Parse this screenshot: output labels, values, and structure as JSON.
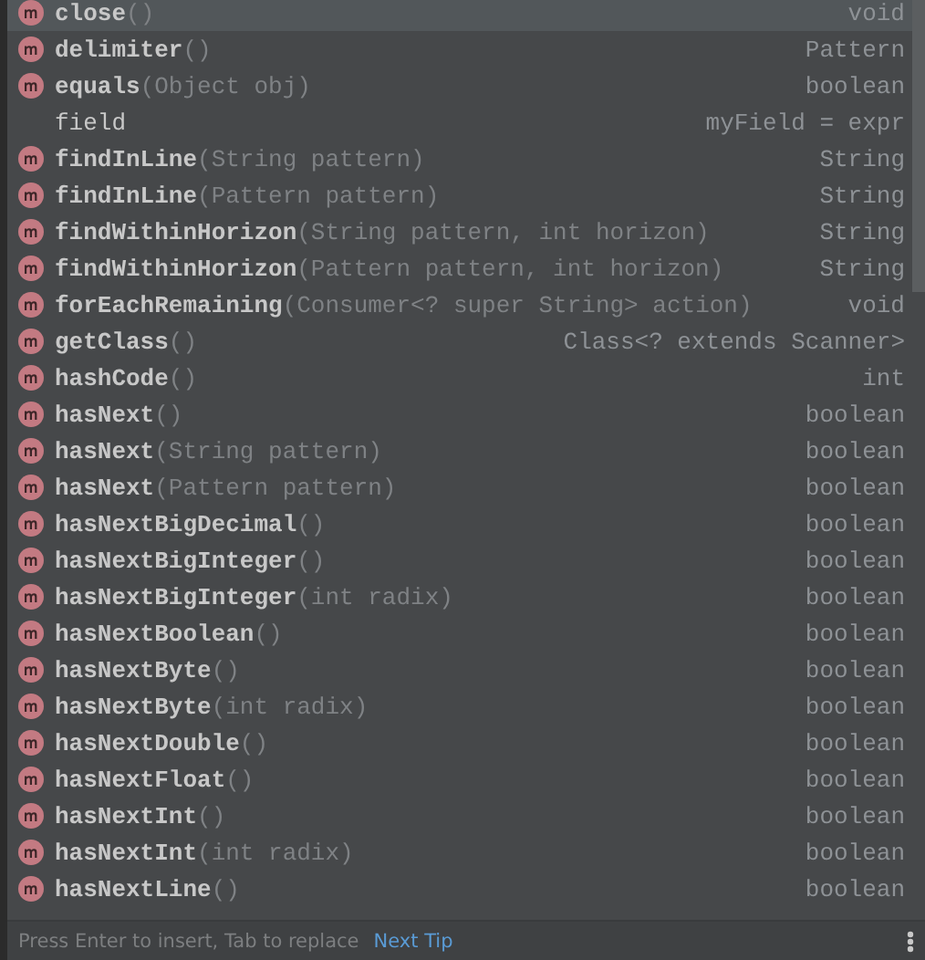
{
  "completion_list": {
    "items": [
      {
        "kind": "method",
        "name": "close",
        "params": "()",
        "type": "void",
        "selected": true
      },
      {
        "kind": "method",
        "name": "delimiter",
        "params": "()",
        "type": "Pattern",
        "selected": false
      },
      {
        "kind": "method",
        "name": "equals",
        "params": "(Object obj)",
        "type": "boolean",
        "selected": false
      },
      {
        "kind": "field",
        "name": "field",
        "type": "myField = expr",
        "selected": false
      },
      {
        "kind": "method",
        "name": "findInLine",
        "params": "(String pattern)",
        "type": "String",
        "selected": false
      },
      {
        "kind": "method",
        "name": "findInLine",
        "params": "(Pattern pattern)",
        "type": "String",
        "selected": false
      },
      {
        "kind": "method",
        "name": "findWithinHorizon",
        "params": "(String pattern, int horizon)",
        "type": "String",
        "selected": false
      },
      {
        "kind": "method",
        "name": "findWithinHorizon",
        "params": "(Pattern pattern, int horizon)",
        "type": "String",
        "selected": false
      },
      {
        "kind": "method",
        "name": "forEachRemaining",
        "params": "(Consumer<? super String> action)",
        "type": "void",
        "selected": false
      },
      {
        "kind": "method",
        "name": "getClass",
        "params": "()",
        "type": "Class<? extends Scanner>",
        "selected": false
      },
      {
        "kind": "method",
        "name": "hashCode",
        "params": "()",
        "type": "int",
        "selected": false
      },
      {
        "kind": "method",
        "name": "hasNext",
        "params": "()",
        "type": "boolean",
        "selected": false
      },
      {
        "kind": "method",
        "name": "hasNext",
        "params": "(String pattern)",
        "type": "boolean",
        "selected": false
      },
      {
        "kind": "method",
        "name": "hasNext",
        "params": "(Pattern pattern)",
        "type": "boolean",
        "selected": false
      },
      {
        "kind": "method",
        "name": "hasNextBigDecimal",
        "params": "()",
        "type": "boolean",
        "selected": false
      },
      {
        "kind": "method",
        "name": "hasNextBigInteger",
        "params": "()",
        "type": "boolean",
        "selected": false
      },
      {
        "kind": "method",
        "name": "hasNextBigInteger",
        "params": "(int radix)",
        "type": "boolean",
        "selected": false
      },
      {
        "kind": "method",
        "name": "hasNextBoolean",
        "params": "()",
        "type": "boolean",
        "selected": false
      },
      {
        "kind": "method",
        "name": "hasNextByte",
        "params": "()",
        "type": "boolean",
        "selected": false
      },
      {
        "kind": "method",
        "name": "hasNextByte",
        "params": "(int radix)",
        "type": "boolean",
        "selected": false
      },
      {
        "kind": "method",
        "name": "hasNextDouble",
        "params": "()",
        "type": "boolean",
        "selected": false
      },
      {
        "kind": "method",
        "name": "hasNextFloat",
        "params": "()",
        "type": "boolean",
        "selected": false
      },
      {
        "kind": "method",
        "name": "hasNextInt",
        "params": "()",
        "type": "boolean",
        "selected": false
      },
      {
        "kind": "method",
        "name": "hasNextInt",
        "params": "(int radix)",
        "type": "boolean",
        "selected": false
      },
      {
        "kind": "method",
        "name": "hasNextLine",
        "params": "()",
        "type": "boolean",
        "selected": false
      }
    ]
  },
  "status_bar": {
    "hint": "Press Enter to insert, Tab to replace",
    "link": "Next Tip"
  }
}
